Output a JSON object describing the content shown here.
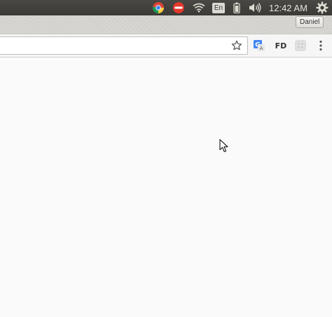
{
  "panel": {
    "language_indicator": "En",
    "clock": "12:42 AM",
    "icons": [
      "chrome-icon",
      "block-icon",
      "wifi-icon",
      "battery-icon",
      "volume-icon",
      "gear-icon"
    ]
  },
  "browser": {
    "profile_name": "Daniel",
    "extensions": {
      "fd_label": "FD",
      "icons": [
        "translate-icon",
        "fd-extension",
        "extension-grey-icon"
      ]
    },
    "omnibox": {
      "value": ""
    },
    "menu_icon": "kebab-menu-icon"
  },
  "colors": {
    "panel_bg": "#3c3b37",
    "tabstrip_bg": "#d6d4d0",
    "toolbar_bg": "#f6f6f6",
    "content_bg": "#fafafa",
    "translate_blue": "#4285f4"
  }
}
